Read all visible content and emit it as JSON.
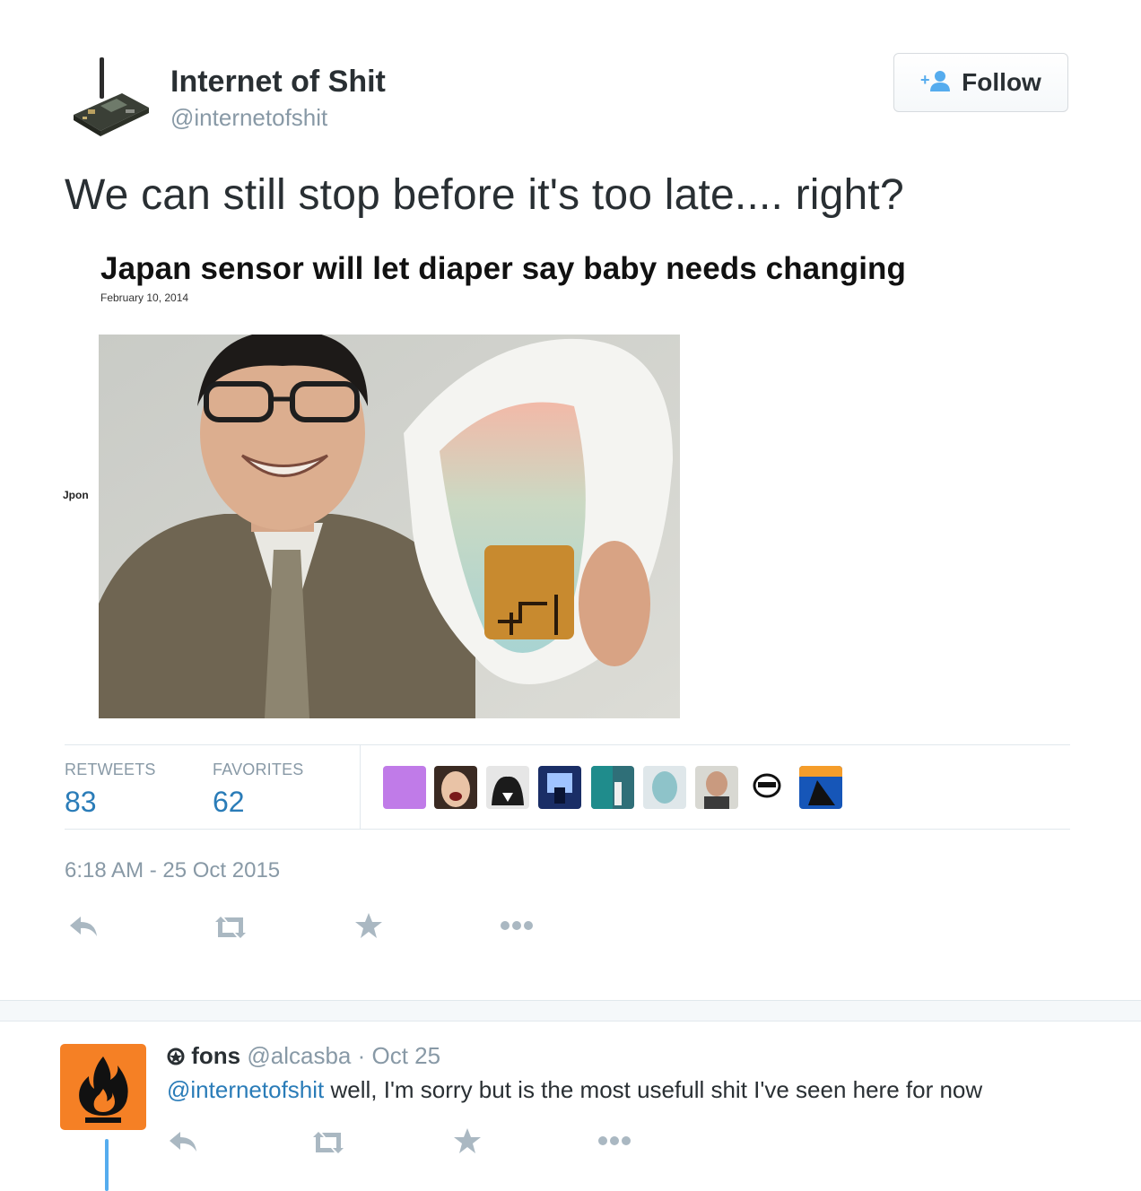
{
  "tweet": {
    "author_name": "Internet of Shit",
    "author_handle": "@internetofshit",
    "follow_label": "Follow",
    "text": "We can still stop before it's too late.... right?",
    "image": {
      "headline": "Japan sensor will let diaper say baby needs changing",
      "date": "February 10, 2014",
      "side_label": "Jpon"
    },
    "stats": {
      "retweets_label": "RETWEETS",
      "retweets_count": "83",
      "favorites_label": "FAVORITES",
      "favorites_count": "62"
    },
    "timestamp": "6:18 AM - 25 Oct 2015"
  },
  "reply": {
    "name": "fons",
    "handle": "@alcasba",
    "date": "Oct 25",
    "mention": "@internetofshit",
    "text": " well, I'm sorry but is the most usefull shit I've seen here for now"
  },
  "colors": {
    "link": "#2a7cb8",
    "muted": "#8899a6",
    "thread_line": "#55acee",
    "reply_avatar": "#f58025"
  },
  "icons": [
    "reply-icon",
    "retweet-icon",
    "favorite-icon",
    "more-icon",
    "follow-person-icon",
    "fire-icon"
  ]
}
